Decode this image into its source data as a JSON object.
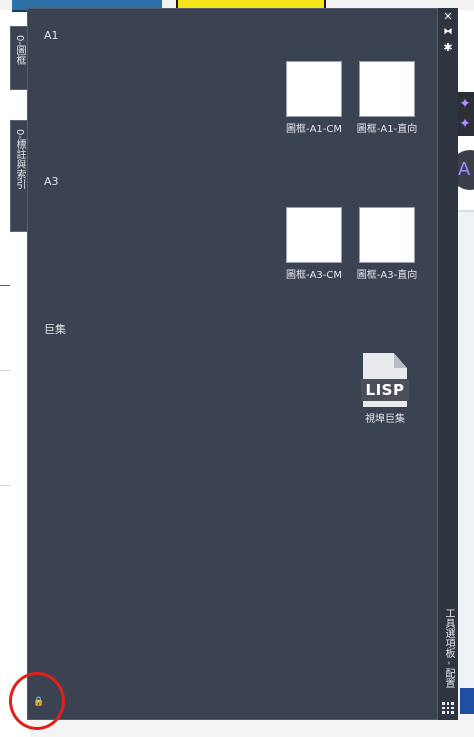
{
  "side_tabs": [
    {
      "label": "0-圖框"
    },
    {
      "label": "0-標註與索引"
    }
  ],
  "palette": {
    "title": "工具選項板 - 配置",
    "buttons": {
      "close": "✕",
      "auto_hide": "⧓",
      "properties": "✱"
    }
  },
  "sections": [
    {
      "title": "A1",
      "tools": [
        {
          "label": "圖框-A1-CM"
        },
        {
          "label": "圖框-A1-直向"
        }
      ]
    },
    {
      "title": "A3",
      "tools": [
        {
          "label": "圖框-A3-CM"
        },
        {
          "label": "圖框-A3-直向"
        }
      ]
    },
    {
      "title": "巨集",
      "tools": [
        {
          "label": "視埠巨集",
          "icon": "lisp-file-icon",
          "badge": "LISP"
        }
      ]
    }
  ],
  "colors": {
    "palette_bg": "#3b4252",
    "titlebar_bg": "#2e3440",
    "highlight_circle": "#e0201b"
  }
}
